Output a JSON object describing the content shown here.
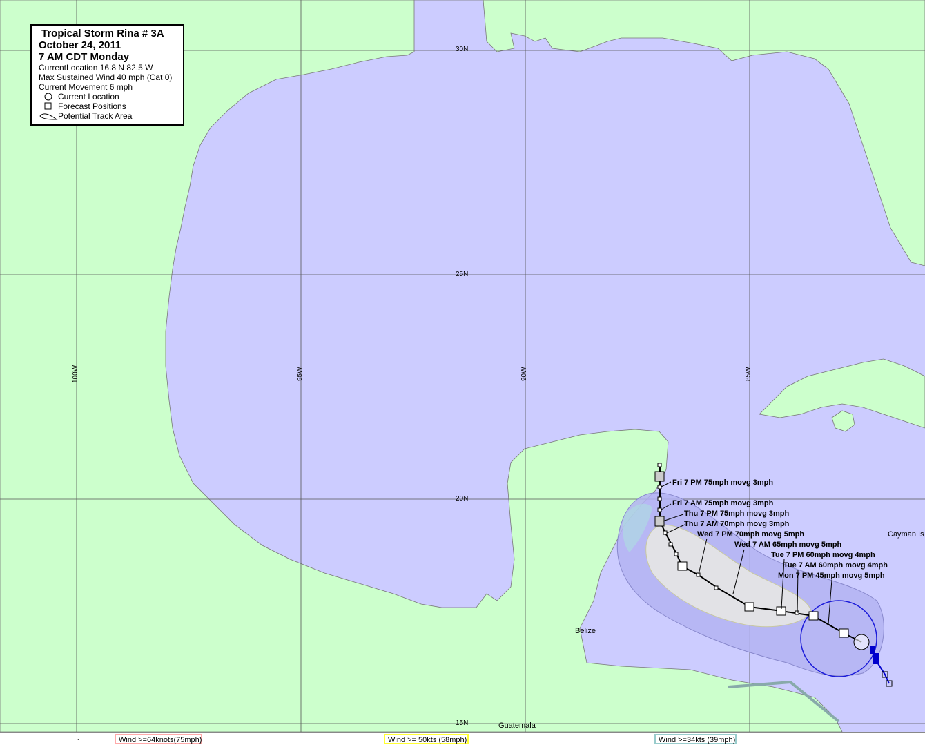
{
  "legend": {
    "title": "Tropical Storm Rina # 3A",
    "date": "October 24, 2011",
    "time": "7 AM CDT Monday",
    "location": "CurrentLocation 16.8 N  82.5 W",
    "max_wind": "Max Sustained Wind 40 mph (Cat 0)",
    "movement": "Current Movement 6 mph",
    "items": [
      "Current Location",
      "Forecast Positions",
      "Potential Track Area"
    ]
  },
  "grid": {
    "lat_labels": [
      "30N",
      "25N",
      "20N",
      "15N"
    ],
    "lon_labels": [
      "100W",
      "95W",
      "90W",
      "85W"
    ]
  },
  "places": {
    "belize": "Belize",
    "guatemala": "Guatemala",
    "cayman": "Cayman Is"
  },
  "forecast_labels": [
    "Fri 7 PM 75mph movg 3mph",
    "Fri 7 AM 75mph movg 3mph",
    "Thu 7 PM 75mph movg 3mph",
    "Thu 7 AM 70mph movg 3mph",
    "Wed 7 PM 70mph movg 5mph",
    "Wed 7 AM 65mph movg 5mph",
    "Tue 7 PM 60mph movg 4mph",
    "Tue 7 AM 60mph movg 4mph",
    "Mon 7 PM 45mph movg 5mph"
  ],
  "wind_key": {
    "w64": "Wind >=64knots(75mph)",
    "w50": "Wind >= 50kts (58mph)",
    "w34": "Wind >=34kts (39mph)"
  },
  "footer_mark": ".",
  "colors": {
    "land": "#ccffcc",
    "water": "#ccccff",
    "cone_outer": "#b3b3f2",
    "cone_inner": "#e2e2e6",
    "wind34": "#aee0e0",
    "wind64": "#ffaaaa",
    "wind50": "#ffff33",
    "wind34_border": "#99cccc",
    "track": "#000000",
    "radius": "#1a1ad9"
  }
}
